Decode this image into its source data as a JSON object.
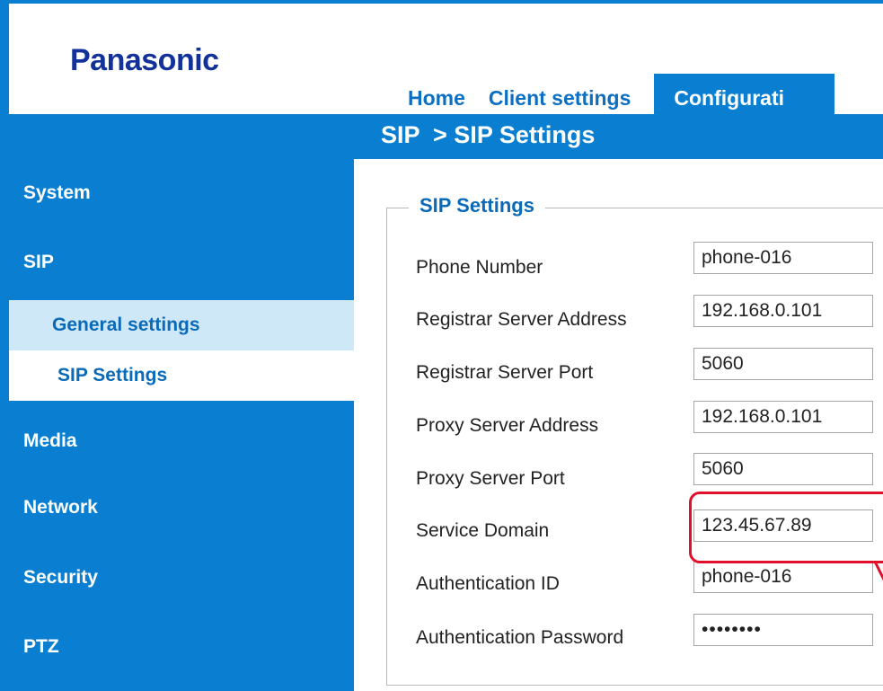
{
  "header": {
    "logo_text": "Panasonic",
    "tabs": [
      {
        "label": "Home"
      },
      {
        "label": "Client settings"
      },
      {
        "label": "Configurati"
      }
    ]
  },
  "breadcrumb": "SIP  > SIP Settings",
  "sidebar": {
    "items": [
      {
        "label": "System"
      },
      {
        "label": "SIP"
      },
      {
        "label": "General settings"
      },
      {
        "label": "SIP Settings"
      },
      {
        "label": "Media"
      },
      {
        "label": "Network"
      },
      {
        "label": "Security"
      },
      {
        "label": "PTZ"
      }
    ]
  },
  "sip_settings": {
    "legend": "SIP Settings",
    "fields": [
      {
        "label": "Phone Number",
        "value": "phone-016"
      },
      {
        "label": "Registrar Server Address",
        "value": "192.168.0.101"
      },
      {
        "label": "Registrar Server Port",
        "value": "5060"
      },
      {
        "label": "Proxy Server Address",
        "value": "192.168.0.101"
      },
      {
        "label": "Proxy Server Port",
        "value": "5060"
      },
      {
        "label": "Service Domain",
        "value": "123.45.67.89"
      },
      {
        "label": "Authentication ID",
        "value": "phone-016"
      },
      {
        "label": "Authentication Password",
        "value": "••••••••"
      }
    ]
  },
  "colors": {
    "brand_blue": "#0a7fd1",
    "logo_navy": "#12329a",
    "highlight_red": "#e0102a",
    "selected_light_blue": "#cfe8f8"
  }
}
